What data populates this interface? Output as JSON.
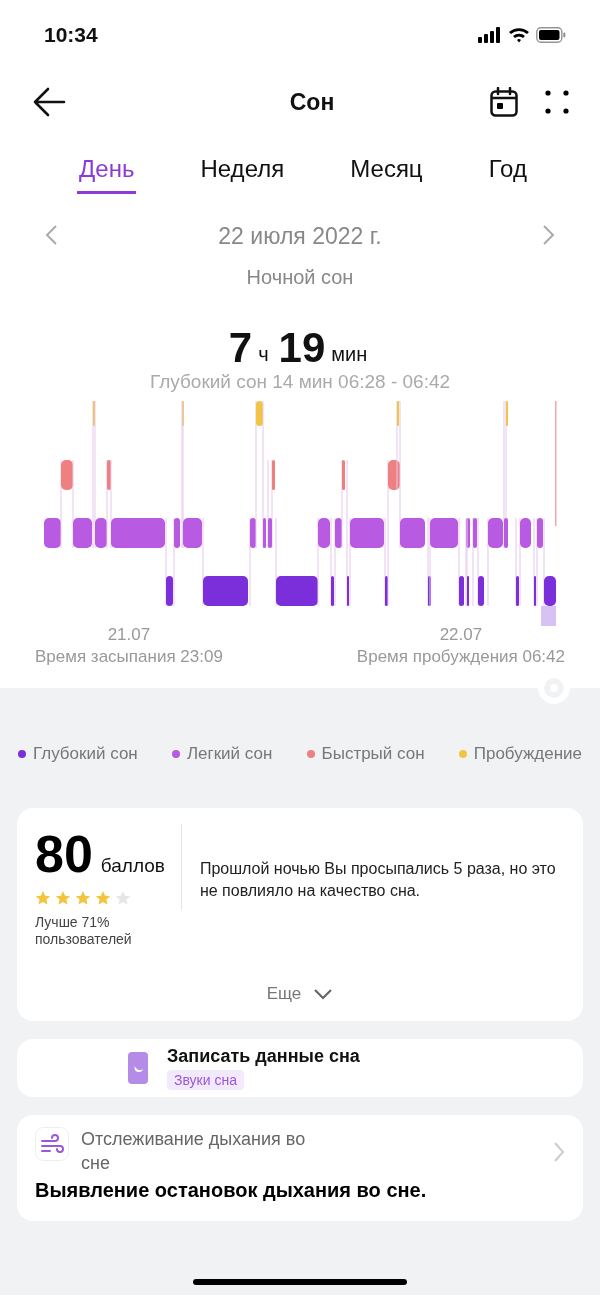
{
  "status_bar": {
    "time": "10:34"
  },
  "header": {
    "title": "Сон"
  },
  "tabs": [
    {
      "label": "День",
      "selected": true
    },
    {
      "label": "Неделя",
      "selected": false
    },
    {
      "label": "Месяц",
      "selected": false
    },
    {
      "label": "Год",
      "selected": false
    }
  ],
  "date_nav": {
    "date": "22 июля 2022 г."
  },
  "sleep": {
    "title": "Ночной сон",
    "hours": "7",
    "hours_unit": "ч",
    "minutes": "19",
    "minutes_unit": "мин",
    "selection": "Глубокий сон 14 мин 06:28 - 06:42",
    "start_date": "21.07",
    "start_label": "Время засыпания 23:09",
    "end_date": "22.07",
    "end_label": "Время пробуждения 06:42"
  },
  "legend": [
    {
      "label": "Глубокий сон",
      "color": "#7b2fdb"
    },
    {
      "label": "Легкий сон",
      "color": "#b85ae2"
    },
    {
      "label": "Быстрый сон",
      "color": "#ee8080"
    },
    {
      "label": "Пробуждение",
      "color": "#f1c443"
    }
  ],
  "score": {
    "value": "80",
    "unit": "баллов",
    "stars": 4,
    "comparison": "Лучше 71% пользователей",
    "message": "Прошлой ночью Вы просыпались 5 раза, но это не повлияло на качество сна.",
    "more": "Еще"
  },
  "record": {
    "title": "Записать данные сна",
    "tag": "Звуки сна"
  },
  "breathing": {
    "title": "Отслеживание дыхания во сне",
    "description": "Выявление остановок дыхания во сне."
  }
}
